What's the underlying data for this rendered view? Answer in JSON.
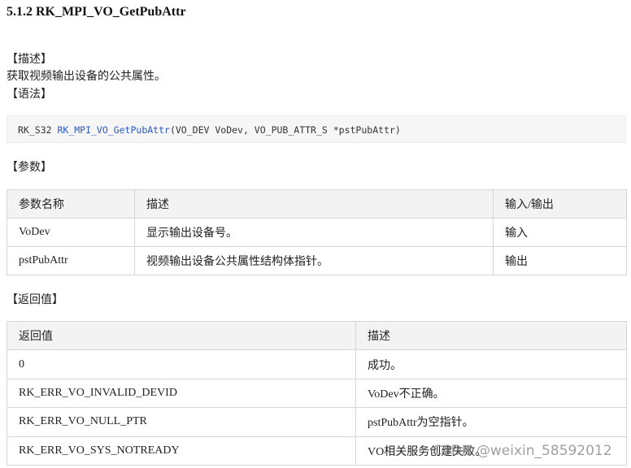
{
  "heading": "5.1.2 RK_MPI_VO_GetPubAttr",
  "section_description_label": "【描述】",
  "description_text": "获取视频输出设备的公共属性。",
  "section_syntax_label": "【语法】",
  "syntax": {
    "return_type": "RK_S32 ",
    "function_name": "RK_MPI_VO_GetPubAttr",
    "params": "(VO_DEV VoDev, VO_PUB_ATTR_S *pstPubAttr)"
  },
  "section_params_label": "【参数】",
  "params_table": {
    "headers": [
      "参数名称",
      "描述",
      "输入/输出"
    ],
    "rows": [
      [
        "VoDev",
        "显示输出设备号。",
        "输入"
      ],
      [
        "pstPubAttr",
        "视频输出设备公共属性结构体指针。",
        "输出"
      ]
    ]
  },
  "section_return_label": "【返回值】",
  "return_table": {
    "headers": [
      "返回值",
      "描述"
    ],
    "rows": [
      [
        "0",
        "成功。"
      ],
      [
        "RK_ERR_VO_INVALID_DEVID",
        "VoDev不正确。"
      ],
      [
        "RK_ERR_VO_NULL_PTR",
        "pstPubAttr为空指针。"
      ],
      [
        "RK_ERR_VO_SYS_NOTREADY",
        "VO相关服务创建失败。"
      ]
    ]
  },
  "watermark": "CSDN @weixin_58592012"
}
